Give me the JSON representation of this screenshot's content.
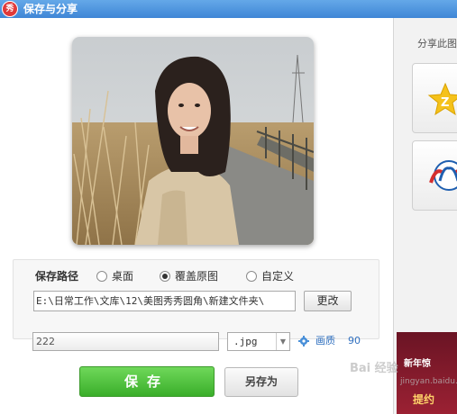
{
  "window": {
    "title": "保存与分享",
    "logo_text": "秀"
  },
  "save_path": {
    "label": "保存路径",
    "options": [
      {
        "label": "桌面",
        "selected": false
      },
      {
        "label": "覆盖原图",
        "selected": true
      },
      {
        "label": "自定义",
        "selected": false
      }
    ],
    "path_value": "E:\\日常工作\\文库\\12\\美图秀秀圆角\\新建文件夹\\",
    "change_button": "更改"
  },
  "file": {
    "name_value": "222",
    "format_value": ".jpg",
    "quality_label": "画质",
    "quality_value": "90"
  },
  "actions": {
    "save_label": "保存",
    "save_as_label": "另存为"
  },
  "share": {
    "label": "分享此图",
    "tiles": [
      {
        "icon": "qzone-star-icon"
      },
      {
        "icon": "renren-icon"
      }
    ]
  },
  "ad": {
    "line1": "新年惊",
    "line2": "提约"
  },
  "watermark": {
    "brand": "Bai 经验",
    "url": "jingyan.baidu.com"
  },
  "colors": {
    "titlebar": "#3f86d6",
    "save_button": "#3aae2a",
    "link": "#2f6fbf"
  }
}
